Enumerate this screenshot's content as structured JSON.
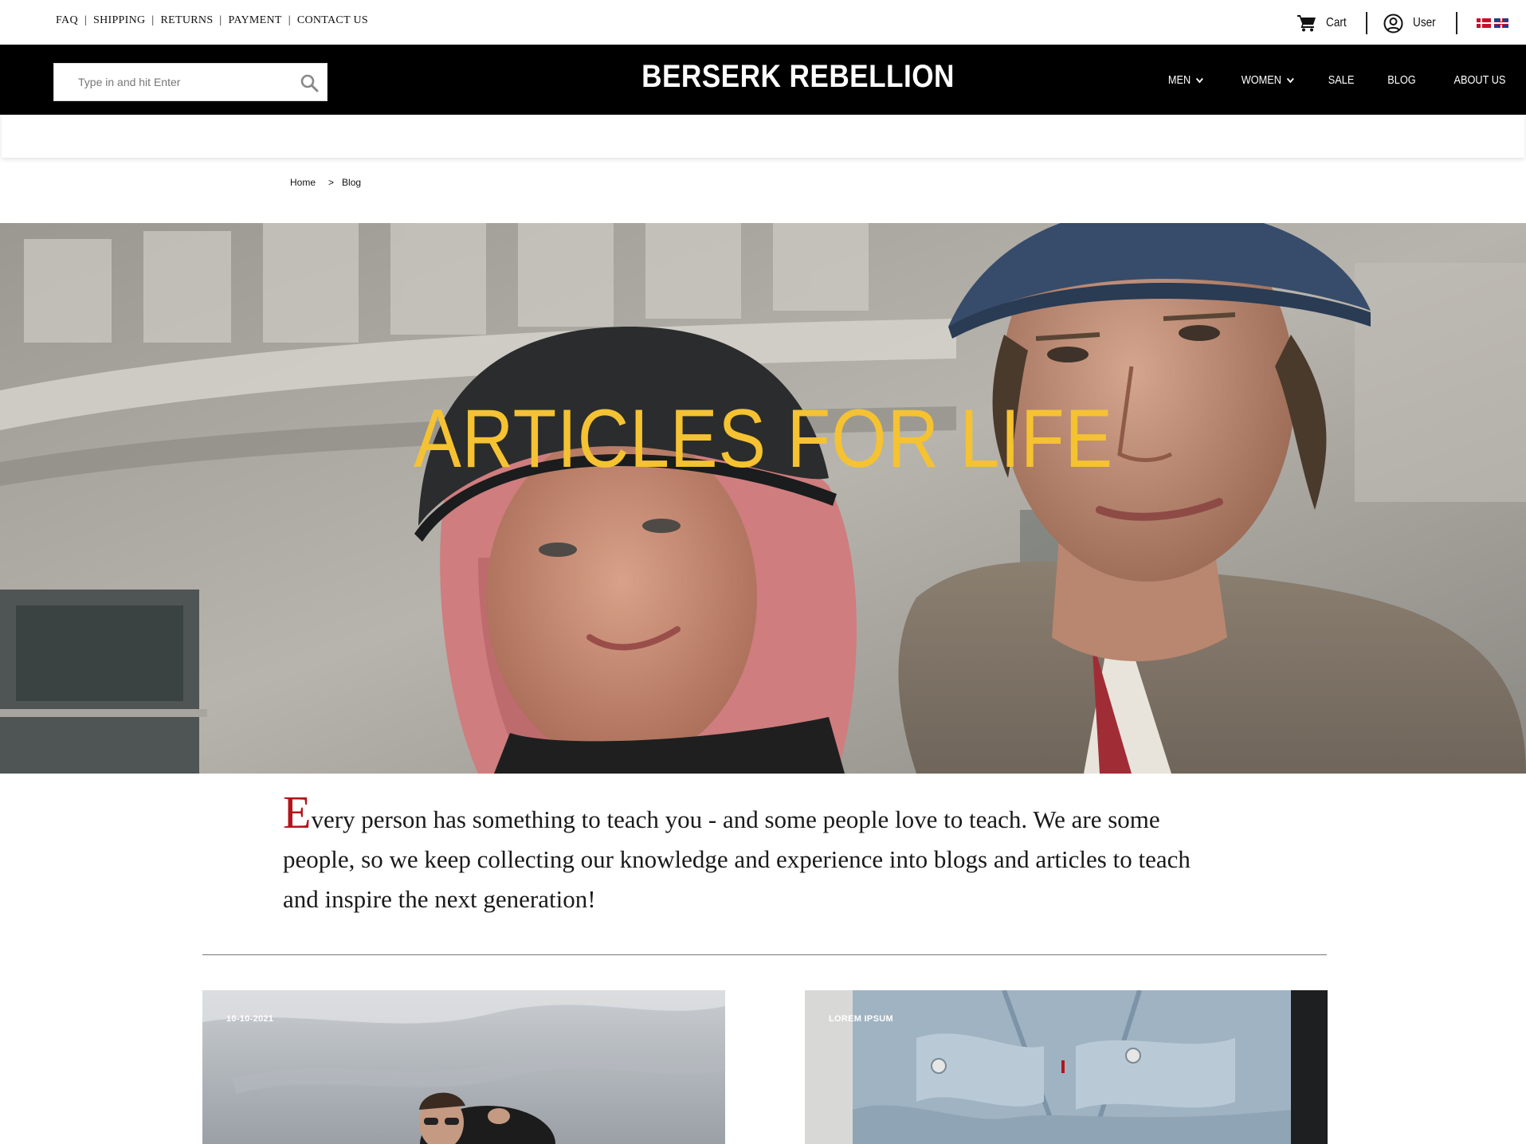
{
  "topbar": {
    "links": [
      {
        "label": "FAQ"
      },
      {
        "label": "SHIPPING"
      },
      {
        "label": "RETURNS"
      },
      {
        "label": "PAYMENT"
      },
      {
        "label": "CONTACT US"
      }
    ],
    "separator": "|",
    "cart_label": "Cart",
    "user_label": "User",
    "languages": [
      "danish-flag-icon",
      "uk-flag-icon"
    ]
  },
  "header": {
    "search_placeholder": "Type in and hit Enter",
    "logo": "BERSERK REBELLION",
    "nav": [
      {
        "label": "MEN",
        "dropdown": true
      },
      {
        "label": "WOMEN",
        "dropdown": true
      },
      {
        "label": "SALE",
        "dropdown": false
      },
      {
        "label": "BLOG",
        "dropdown": false
      },
      {
        "label": "ABOUT US",
        "dropdown": false
      }
    ]
  },
  "breadcrumb": {
    "home": "Home",
    "separator": ">",
    "current": "Blog"
  },
  "hero": {
    "title": "ARTICLES FOR LIFE",
    "title_color": "#f5c232"
  },
  "intro": {
    "dropcap": "E",
    "text": "very person has something to teach you - and some people love to teach. We are some people, so we keep collecting our knowledge and experience into blogs and articles to teach and inspire the next generation!",
    "dropcap_color": "#b3151b"
  },
  "cards": [
    {
      "tag": "10-10-2021"
    },
    {
      "tag": "LOREM IPSUM"
    }
  ]
}
